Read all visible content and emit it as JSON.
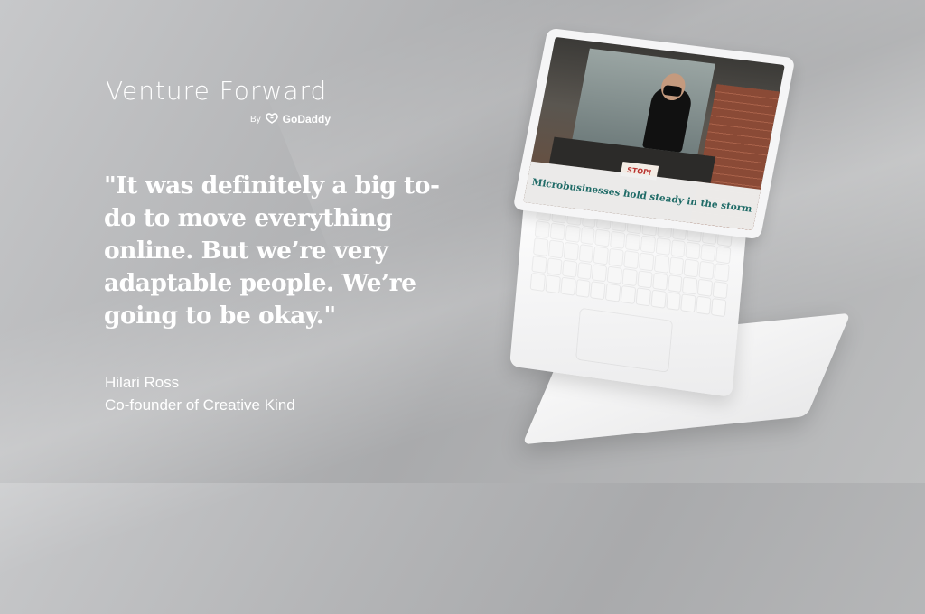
{
  "brand": {
    "title": "Venture Forward",
    "by": "By",
    "company": "GoDaddy"
  },
  "quote": {
    "text": "\"It was definitely a big to-do to move everything online. But we’re very adaptable people. We’re going to be okay.\""
  },
  "author": {
    "name": "Hilari Ross",
    "role": "Co-founder of Creative Kind"
  },
  "laptop": {
    "headline": "Microbusinesses hold steady in the storm",
    "sign": "STOP!"
  },
  "colors": {
    "headline": "#1f6b67",
    "text": "#ffffff"
  }
}
